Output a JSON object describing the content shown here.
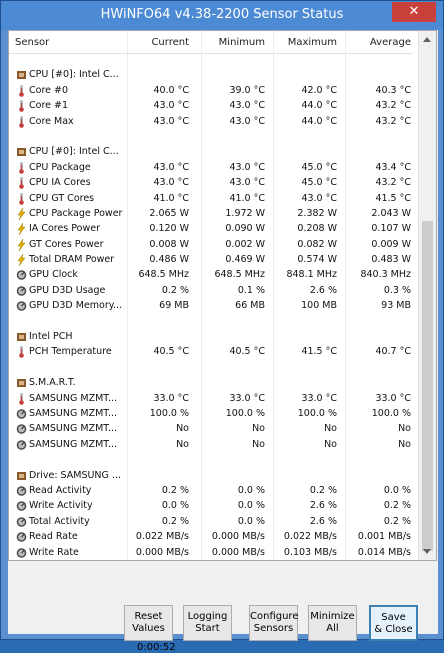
{
  "window": {
    "title": "HWiNFO64 v4.38-2200 Sensor Status",
    "close_glyph": "✕"
  },
  "columns": {
    "sensor": "Sensor",
    "current": "Current",
    "minimum": "Minimum",
    "maximum": "Maximum",
    "average": "Average"
  },
  "rows": [
    {
      "type": "blank"
    },
    {
      "type": "group",
      "icon": "chip-icon",
      "label": "CPU [#0]: Intel C..."
    },
    {
      "type": "item",
      "icon": "thermometer-icon",
      "label": "Core #0",
      "cur": "40.0 °C",
      "min": "39.0 °C",
      "max": "42.0 °C",
      "avg": "40.3 °C"
    },
    {
      "type": "item",
      "icon": "thermometer-icon",
      "label": "Core #1",
      "cur": "43.0 °C",
      "min": "43.0 °C",
      "max": "44.0 °C",
      "avg": "43.2 °C"
    },
    {
      "type": "item",
      "icon": "thermometer-icon",
      "label": "Core Max",
      "cur": "43.0 °C",
      "min": "43.0 °C",
      "max": "44.0 °C",
      "avg": "43.2 °C"
    },
    {
      "type": "blank"
    },
    {
      "type": "group",
      "icon": "chip-icon",
      "label": "CPU [#0]: Intel C..."
    },
    {
      "type": "item",
      "icon": "thermometer-icon",
      "label": "CPU Package",
      "cur": "43.0 °C",
      "min": "43.0 °C",
      "max": "45.0 °C",
      "avg": "43.4 °C"
    },
    {
      "type": "item",
      "icon": "thermometer-icon",
      "label": "CPU IA Cores",
      "cur": "43.0 °C",
      "min": "43.0 °C",
      "max": "45.0 °C",
      "avg": "43.2 °C"
    },
    {
      "type": "item",
      "icon": "thermometer-icon",
      "label": "CPU GT Cores",
      "cur": "41.0 °C",
      "min": "41.0 °C",
      "max": "43.0 °C",
      "avg": "41.5 °C"
    },
    {
      "type": "item",
      "icon": "lightning-icon",
      "label": "CPU Package Power",
      "cur": "2.065 W",
      "min": "1.972 W",
      "max": "2.382 W",
      "avg": "2.043 W"
    },
    {
      "type": "item",
      "icon": "lightning-icon",
      "label": "IA Cores Power",
      "cur": "0.120 W",
      "min": "0.090 W",
      "max": "0.208 W",
      "avg": "0.107 W"
    },
    {
      "type": "item",
      "icon": "lightning-icon",
      "label": "GT Cores Power",
      "cur": "0.008 W",
      "min": "0.002 W",
      "max": "0.082 W",
      "avg": "0.009 W"
    },
    {
      "type": "item",
      "icon": "lightning-icon",
      "label": "Total DRAM Power",
      "cur": "0.486 W",
      "min": "0.469 W",
      "max": "0.574 W",
      "avg": "0.483 W"
    },
    {
      "type": "item",
      "icon": "gauge-icon",
      "label": "GPU Clock",
      "cur": "648.5 MHz",
      "min": "648.5 MHz",
      "max": "848.1 MHz",
      "avg": "840.3 MHz"
    },
    {
      "type": "item",
      "icon": "gauge-icon",
      "label": "GPU D3D Usage",
      "cur": "0.2 %",
      "min": "0.1 %",
      "max": "2.6 %",
      "avg": "0.3 %"
    },
    {
      "type": "item",
      "icon": "gauge-icon",
      "label": "GPU D3D Memory...",
      "cur": "69 MB",
      "min": "66 MB",
      "max": "100 MB",
      "avg": "93 MB"
    },
    {
      "type": "blank"
    },
    {
      "type": "group",
      "icon": "chip-icon",
      "label": "Intel PCH"
    },
    {
      "type": "item",
      "icon": "thermometer-icon",
      "label": "PCH Temperature",
      "cur": "40.5 °C",
      "min": "40.5 °C",
      "max": "41.5 °C",
      "avg": "40.7 °C"
    },
    {
      "type": "blank"
    },
    {
      "type": "group",
      "icon": "chip-icon",
      "label": "S.M.A.R.T."
    },
    {
      "type": "item",
      "icon": "thermometer-icon",
      "label": "SAMSUNG MZMT...",
      "cur": "33.0 °C",
      "min": "33.0 °C",
      "max": "33.0 °C",
      "avg": "33.0 °C"
    },
    {
      "type": "item",
      "icon": "gauge-icon",
      "label": "SAMSUNG MZMT...",
      "cur": "100.0 %",
      "min": "100.0 %",
      "max": "100.0 %",
      "avg": "100.0 %"
    },
    {
      "type": "item",
      "icon": "gauge-icon",
      "label": "SAMSUNG MZMT...",
      "cur": "No",
      "min": "No",
      "max": "No",
      "avg": "No"
    },
    {
      "type": "item",
      "icon": "gauge-icon",
      "label": "SAMSUNG MZMT...",
      "cur": "No",
      "min": "No",
      "max": "No",
      "avg": "No"
    },
    {
      "type": "blank"
    },
    {
      "type": "group",
      "icon": "chip-icon",
      "label": "Drive: SAMSUNG ..."
    },
    {
      "type": "item",
      "icon": "gauge-icon",
      "label": "Read Activity",
      "cur": "0.2 %",
      "min": "0.0 %",
      "max": "0.2 %",
      "avg": "0.0 %"
    },
    {
      "type": "item",
      "icon": "gauge-icon",
      "label": "Write Activity",
      "cur": "0.0 %",
      "min": "0.0 %",
      "max": "2.6 %",
      "avg": "0.2 %"
    },
    {
      "type": "item",
      "icon": "gauge-icon",
      "label": "Total Activity",
      "cur": "0.2 %",
      "min": "0.0 %",
      "max": "2.6 %",
      "avg": "0.2 %"
    },
    {
      "type": "item",
      "icon": "gauge-icon",
      "label": "Read Rate",
      "cur": "0.022 MB/s",
      "min": "0.000 MB/s",
      "max": "0.022 MB/s",
      "avg": "0.001 MB/s"
    },
    {
      "type": "item",
      "icon": "gauge-icon",
      "label": "Write Rate",
      "cur": "0.000 MB/s",
      "min": "0.000 MB/s",
      "max": "0.103 MB/s",
      "avg": "0.014 MB/s"
    }
  ],
  "buttons": {
    "reset": {
      "line1": "Reset",
      "line2": "Values"
    },
    "logging": {
      "line1": "Logging",
      "line2": "Start"
    },
    "configure": {
      "line1": "Configure",
      "line2": "Sensors"
    },
    "minimize": {
      "line1": "Minimize",
      "line2": "All"
    },
    "save": {
      "line1": "Save",
      "line2": "& Close"
    }
  },
  "timer": "0:00:52",
  "colors": {
    "title_bar": "#4d8ad4",
    "close": "#c7413a",
    "chip": "#8a5a2b",
    "thermo": "#c43c3c",
    "lightning": "#e0b000",
    "gauge": "#4a4a4a"
  }
}
